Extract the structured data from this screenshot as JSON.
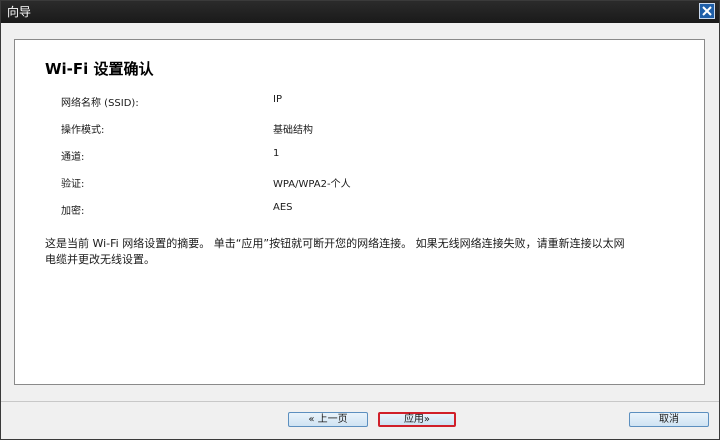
{
  "window": {
    "title": "向导",
    "close_icon": "close-icon"
  },
  "content": {
    "heading": "Wi-Fi 设置确认",
    "fields": [
      {
        "label": "网络名称 (SSID):",
        "value": "IP"
      },
      {
        "label": "操作模式:",
        "value": "基础结构"
      },
      {
        "label": "通道:",
        "value": "1"
      },
      {
        "label": "验证:",
        "value": "WPA/WPA2-个人"
      },
      {
        "label": "加密:",
        "value": "AES"
      }
    ],
    "summary_line1": "这是当前 Wi-Fi 网络设置的摘要。 单击“应用”按钮就可断开您的网络连接。 如果无线网络连接失败，请重新连接以太网",
    "summary_line2": "电缆并更改无线设置。"
  },
  "buttons": {
    "back": "« 上一页",
    "apply": "应用»",
    "cancel": "取消"
  },
  "colors": {
    "titlebar": "#1a1a1a",
    "close_button": "#1f5fa8",
    "apply_highlight": "#d0202a",
    "button_border": "#5c8fbf"
  }
}
